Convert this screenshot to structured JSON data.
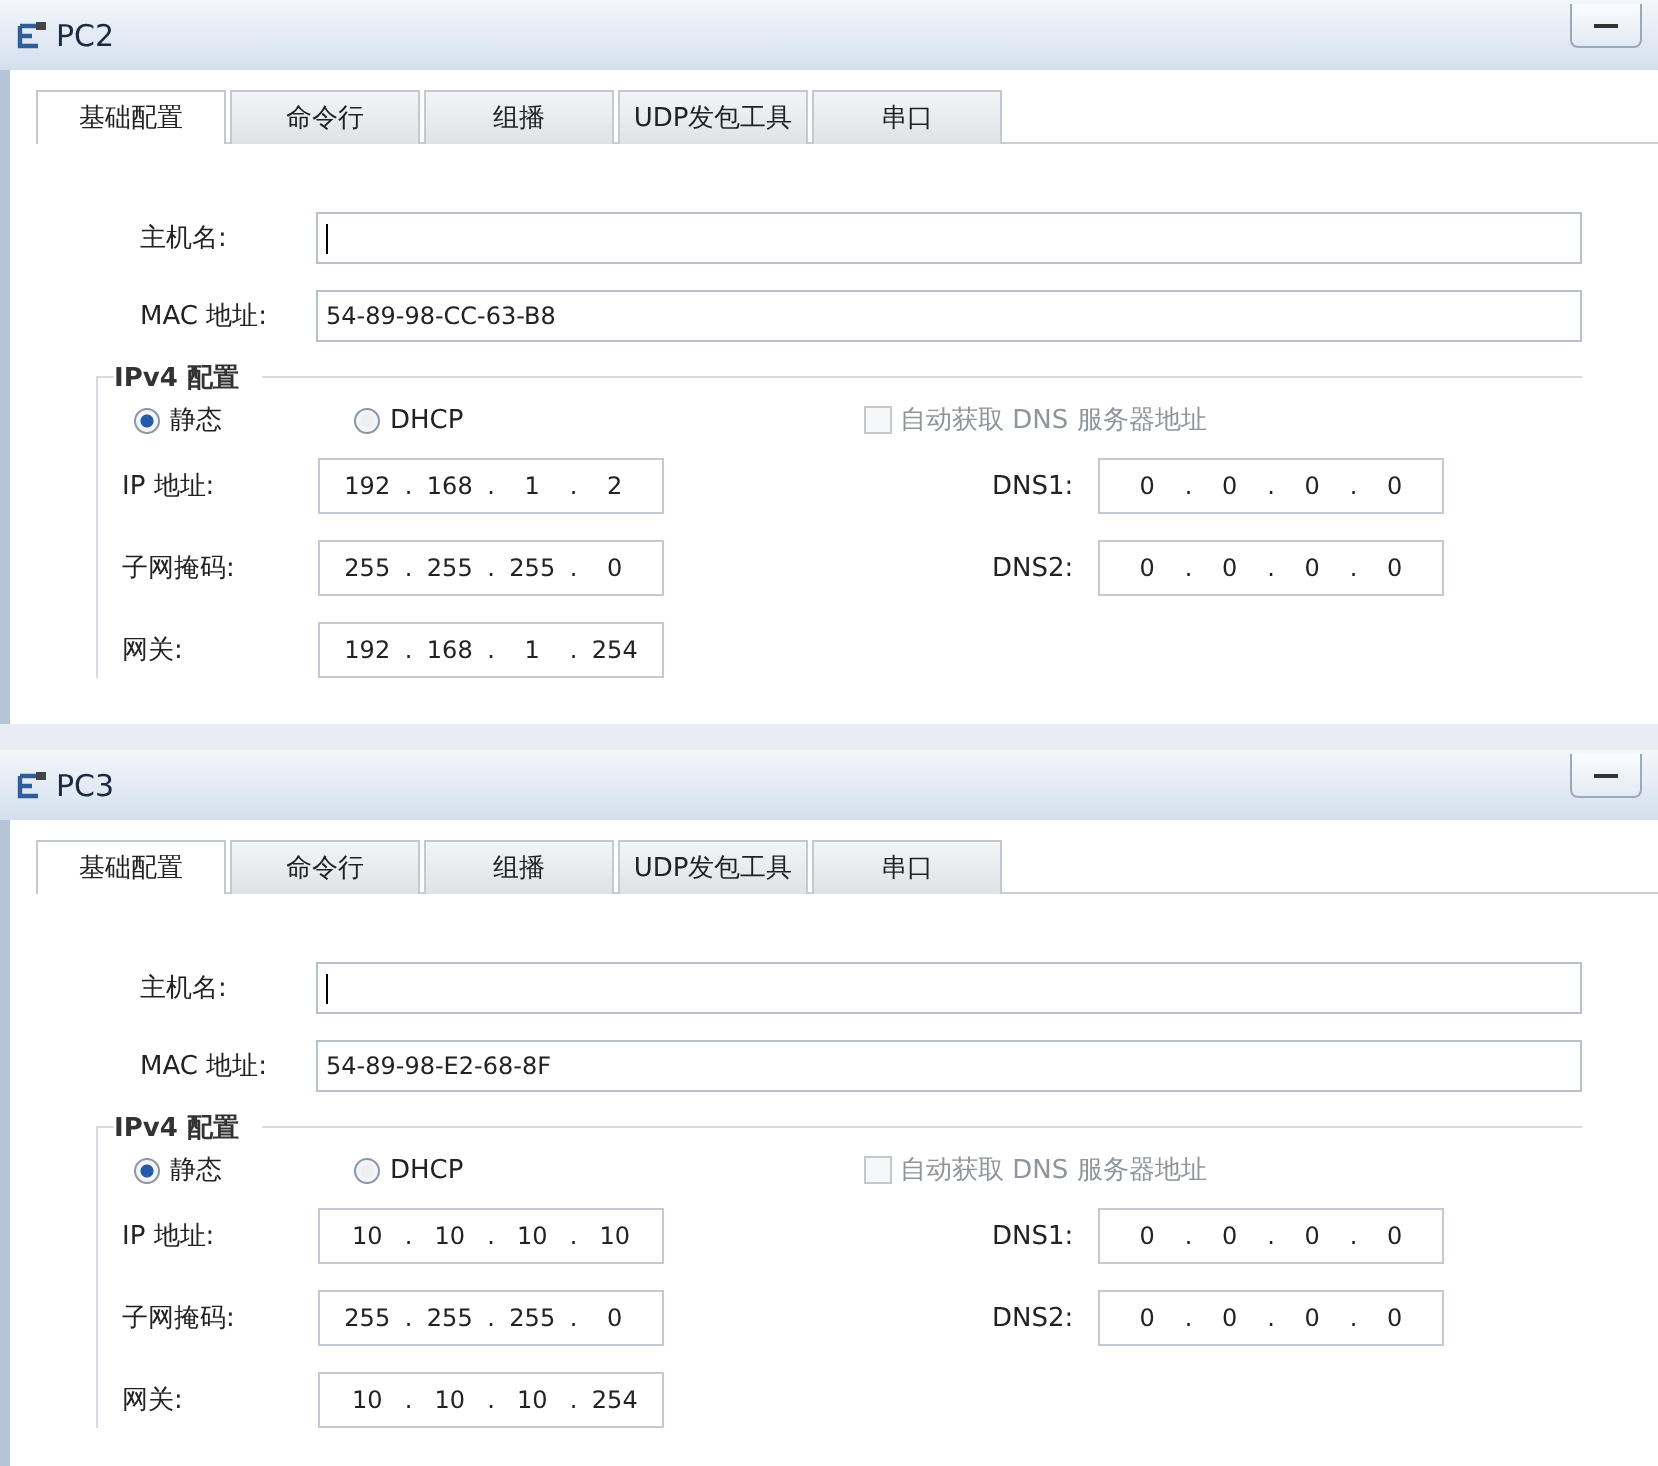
{
  "windows": [
    {
      "title": "PC2",
      "tabs": [
        {
          "label": "基础配置",
          "selected": true
        },
        {
          "label": "命令行",
          "selected": false
        },
        {
          "label": "组播",
          "selected": false
        },
        {
          "label": "UDP发包工具",
          "selected": false
        },
        {
          "label": "串口",
          "selected": false
        }
      ],
      "host": {
        "label": "主机名:",
        "focused": true
      },
      "mac": {
        "label": "MAC 地址:",
        "value": "54-89-98-CC-63-B8"
      },
      "ipv4": {
        "legend": "IPv4 配置",
        "modes": [
          {
            "label": "静态",
            "selected": true
          },
          {
            "label": "DHCP",
            "selected": false
          }
        ],
        "auto_dns": {
          "label": "自动获取 DNS 服务器地址",
          "checked": false,
          "disabled": true
        },
        "left": [
          {
            "label": "IP 地址:",
            "parts": [
              "192",
              ".",
              "168",
              ".",
              "1",
              ".",
              "2"
            ]
          },
          {
            "label": "子网掩码:",
            "parts": [
              "255",
              ".",
              "255",
              ".",
              "255",
              ".",
              "0"
            ]
          },
          {
            "label": "网关:",
            "parts": [
              "192",
              ".",
              "168",
              ".",
              "1",
              ".",
              "254"
            ]
          }
        ],
        "right": [
          {
            "label": "DNS1:",
            "parts": [
              "0",
              ".",
              "0",
              ".",
              "0",
              ".",
              "0"
            ]
          },
          {
            "label": "DNS2:",
            "parts": [
              "0",
              ".",
              "0",
              ".",
              "0",
              ".",
              "0"
            ]
          }
        ]
      }
    },
    {
      "title": "PC3",
      "tabs": [
        {
          "label": "基础配置",
          "selected": true
        },
        {
          "label": "命令行",
          "selected": false
        },
        {
          "label": "组播",
          "selected": false
        },
        {
          "label": "UDP发包工具",
          "selected": false
        },
        {
          "label": "串口",
          "selected": false
        }
      ],
      "host": {
        "label": "主机名:",
        "focused": true
      },
      "mac": {
        "label": "MAC 地址:",
        "value": "54-89-98-E2-68-8F"
      },
      "ipv4": {
        "legend": "IPv4 配置",
        "modes": [
          {
            "label": "静态",
            "selected": true
          },
          {
            "label": "DHCP",
            "selected": false
          }
        ],
        "auto_dns": {
          "label": "自动获取 DNS 服务器地址",
          "checked": false,
          "disabled": true
        },
        "left": [
          {
            "label": "IP 地址:",
            "parts": [
              "10",
              ".",
              "10",
              ".",
              "10",
              ".",
              "10"
            ]
          },
          {
            "label": "子网掩码:",
            "parts": [
              "255",
              ".",
              "255",
              ".",
              "255",
              ".",
              "0"
            ]
          },
          {
            "label": "网关:",
            "parts": [
              "10",
              ".",
              "10",
              ".",
              "10",
              ".",
              "254"
            ]
          }
        ],
        "right": [
          {
            "label": "DNS1:",
            "parts": [
              "0",
              ".",
              "0",
              ".",
              "0",
              ".",
              "0"
            ]
          },
          {
            "label": "DNS2:",
            "parts": [
              "0",
              ".",
              "0",
              ".",
              "0",
              ".",
              "0"
            ]
          }
        ]
      }
    }
  ]
}
